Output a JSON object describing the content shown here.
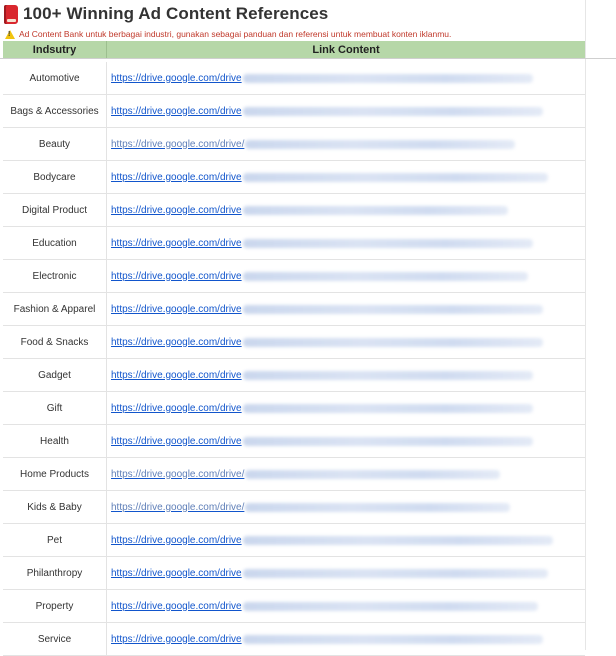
{
  "header": {
    "title": "100+ Winning Ad Content References",
    "notice": "Ad Content Bank untuk berbagai industri, gunakan sebagai panduan dan referensi untuk membuat konten iklanmu."
  },
  "table": {
    "columns": [
      "Indsutry",
      "Link Content"
    ],
    "rows": [
      {
        "industry": "Automotive",
        "link": "https://drive.google.com/drive"
      },
      {
        "industry": "Bags & Accessories",
        "link": "https://drive.google.com/drive"
      },
      {
        "industry": "Beauty",
        "link": "https://drive.google.com/drive/"
      },
      {
        "industry": "Bodycare",
        "link": "https://drive.google.com/drive"
      },
      {
        "industry": "Digital Product",
        "link": "https://drive.google.com/drive"
      },
      {
        "industry": "Education",
        "link": "https://drive.google.com/drive"
      },
      {
        "industry": "Electronic",
        "link": "https://drive.google.com/drive"
      },
      {
        "industry": "Fashion & Apparel",
        "link": "https://drive.google.com/drive"
      },
      {
        "industry": "Food & Snacks",
        "link": "https://drive.google.com/drive"
      },
      {
        "industry": "Gadget",
        "link": "https://drive.google.com/drive"
      },
      {
        "industry": "Gift",
        "link": "https://drive.google.com/drive"
      },
      {
        "industry": "Health",
        "link": "https://drive.google.com/drive"
      },
      {
        "industry": "Home Products",
        "link": "https://drive.google.com/drive/"
      },
      {
        "industry": "Kids & Baby",
        "link": "https://drive.google.com/drive/"
      },
      {
        "industry": "Pet",
        "link": "https://drive.google.com/drive"
      },
      {
        "industry": "Philanthropy",
        "link": "https://drive.google.com/drive"
      },
      {
        "industry": "Property",
        "link": "https://drive.google.com/drive"
      },
      {
        "industry": "Service",
        "link": "https://drive.google.com/drive"
      }
    ]
  },
  "colors": {
    "header_bg": "#b6d7a8",
    "link": "#1155cc",
    "notice": "#c0392b",
    "title_icon": "#d9272e"
  },
  "icons": {
    "title": "book-icon",
    "notice": "warning-icon"
  }
}
